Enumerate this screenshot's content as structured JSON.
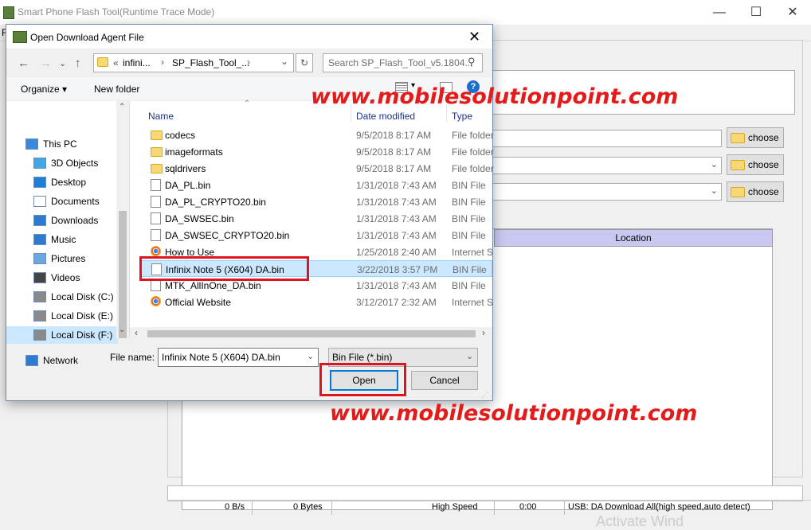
{
  "main_window": {
    "title": "Smart Phone Flash Tool(Runtime Trace Mode)",
    "controls": {
      "minimize": "—",
      "maximize": "☐",
      "close": "✕"
    },
    "menu_fragment": "F",
    "choose_label": "choose",
    "location_header": "Location",
    "status": {
      "speed": "0 B/s",
      "bytes": "0 Bytes",
      "mode": "High Speed",
      "time": "0:00",
      "usb": "USB: DA Download All(high speed,auto detect)"
    },
    "faint_text": "Activate Wind"
  },
  "dialog": {
    "title": "Open Download Agent File",
    "close": "✕",
    "nav": {
      "back": "←",
      "forward": "→",
      "dropdown": "⌄",
      "up": "↑"
    },
    "address": {
      "prefix": "«",
      "part1": "infini...",
      "part2": "SP_Flash_Tool_...",
      "sep": "›"
    },
    "search_placeholder": "Search SP_Flash_Tool_v5.1804...",
    "toolbar": {
      "organize": "Organize",
      "new_folder": "New folder"
    },
    "nav_pane": [
      {
        "label": "This PC",
        "icon": "pc-icon",
        "color": "#3b8ad9"
      },
      {
        "label": "3D Objects",
        "icon": "cube-icon",
        "color": "#3fa9e8"
      },
      {
        "label": "Desktop",
        "icon": "desktop-icon",
        "color": "#1f7fd6"
      },
      {
        "label": "Documents",
        "icon": "document-icon",
        "color": "#ffffff"
      },
      {
        "label": "Downloads",
        "icon": "download-icon",
        "color": "#2c7bd1"
      },
      {
        "label": "Music",
        "icon": "music-icon",
        "color": "#2c7bd1"
      },
      {
        "label": "Pictures",
        "icon": "picture-icon",
        "color": "#6aa9e0"
      },
      {
        "label": "Videos",
        "icon": "video-icon",
        "color": "#444444"
      },
      {
        "label": "Local Disk (C:)",
        "icon": "drive-icon",
        "color": "#8a8a8a"
      },
      {
        "label": "Local Disk (E:)",
        "icon": "drive-icon",
        "color": "#8a8a8a"
      },
      {
        "label": "Local Disk (F:)",
        "icon": "drive-icon",
        "color": "#8a8a8a"
      },
      {
        "label": "Network",
        "icon": "network-icon",
        "color": "#2c7bd1"
      }
    ],
    "columns": {
      "name": "Name",
      "date": "Date modified",
      "type": "Type"
    },
    "files": [
      {
        "name": "codecs",
        "date": "9/5/2018 8:17 AM",
        "type": "File folder",
        "kind": "folder"
      },
      {
        "name": "imageformats",
        "date": "9/5/2018 8:17 AM",
        "type": "File folder",
        "kind": "folder"
      },
      {
        "name": "sqldrivers",
        "date": "9/5/2018 8:17 AM",
        "type": "File folder",
        "kind": "folder"
      },
      {
        "name": "DA_PL.bin",
        "date": "1/31/2018 7:43 AM",
        "type": "BIN File",
        "kind": "file"
      },
      {
        "name": "DA_PL_CRYPTO20.bin",
        "date": "1/31/2018 7:43 AM",
        "type": "BIN File",
        "kind": "file"
      },
      {
        "name": "DA_SWSEC.bin",
        "date": "1/31/2018 7:43 AM",
        "type": "BIN File",
        "kind": "file"
      },
      {
        "name": "DA_SWSEC_CRYPTO20.bin",
        "date": "1/31/2018 7:43 AM",
        "type": "BIN File",
        "kind": "file"
      },
      {
        "name": "How to Use",
        "date": "1/25/2018 2:40 AM",
        "type": "Internet S",
        "kind": "web"
      },
      {
        "name": "Infinix Note 5 (X604) DA.bin",
        "date": "3/22/2018 3:57 PM",
        "type": "BIN File",
        "kind": "file",
        "selected": true
      },
      {
        "name": "MTK_AllInOne_DA.bin",
        "date": "1/31/2018 7:43 AM",
        "type": "BIN File",
        "kind": "file"
      },
      {
        "name": "Official Website",
        "date": "3/12/2017 2:32 AM",
        "type": "Internet S",
        "kind": "web"
      }
    ],
    "filename_label": "File name:",
    "filename_value": "Infinix Note 5 (X604) DA.bin",
    "filetype_value": "Bin File (*.bin)",
    "open_label": "Open",
    "cancel_label": "Cancel"
  },
  "watermarks": [
    "www.mobilesolutionpoint.com",
    "www.mobilesolutionpoint.com"
  ]
}
